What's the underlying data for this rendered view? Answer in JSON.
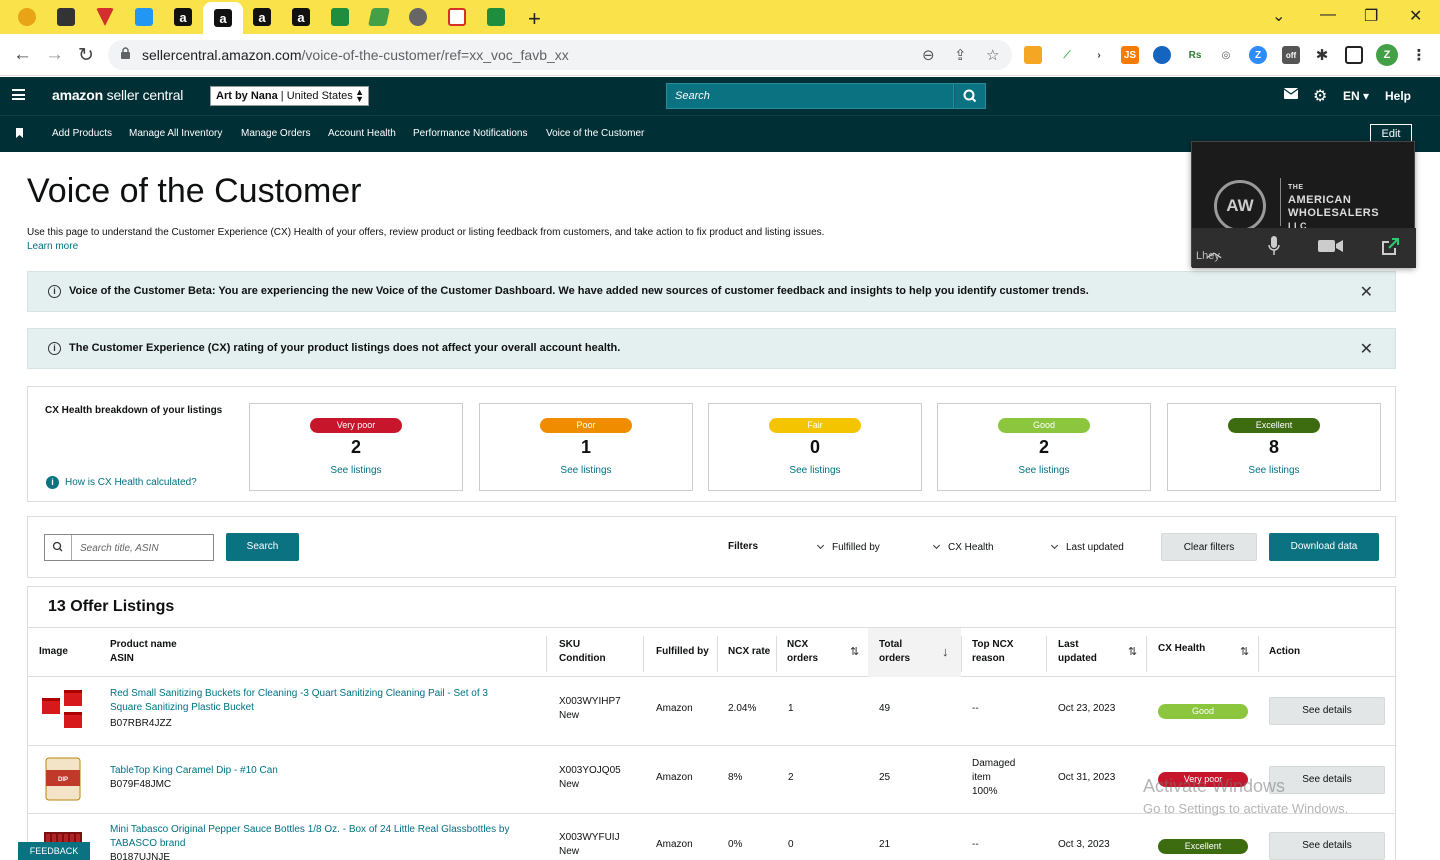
{
  "browser": {
    "url_host": "sellercentral.amazon.com",
    "url_path": "/voice-of-the-customer/ref=xx_voc_favb_xx",
    "new_tab_label": "+",
    "tab_glyphs": [
      "a",
      "a",
      "a",
      "a"
    ]
  },
  "header": {
    "logo_main": "amazon",
    "logo_sub": "seller central",
    "store_name": "Art by Nana",
    "store_region": "United States",
    "search_placeholder": "Search",
    "lang": "EN",
    "help": "Help"
  },
  "nav": {
    "items": [
      "Add Products",
      "Manage All Inventory",
      "Manage Orders",
      "Account Health",
      "Performance Notifications",
      "Voice of the Customer"
    ],
    "edit": "Edit"
  },
  "page": {
    "title": "Voice of the Customer",
    "description": "Use this page to understand the Customer Experience (CX) Health of your offers, review product or listing feedback from customers, and take action to fix product and listing issues.",
    "learn_more": "Learn more"
  },
  "banners": [
    "Voice of the Customer Beta: You are experiencing the new Voice of the Customer Dashboard. We have added new sources of customer feedback and insights to help you identify customer trends.",
    "The Customer Experience (CX) rating of your product listings does not affect your overall account health."
  ],
  "cx_health": {
    "label": "CX Health breakdown of your listings",
    "how_link": "How is CX Health calculated?",
    "see_listings": "See listings",
    "cards": [
      {
        "rating": "Very poor",
        "count": "2",
        "color": "#c7162b"
      },
      {
        "rating": "Poor",
        "count": "1",
        "color": "#f08c00"
      },
      {
        "rating": "Fair",
        "count": "0",
        "color": "#f5c400"
      },
      {
        "rating": "Good",
        "count": "2",
        "color": "#8cc63f"
      },
      {
        "rating": "Excellent",
        "count": "8",
        "color": "#3d6b10"
      }
    ]
  },
  "filters": {
    "search_placeholder": "Search title, ASIN",
    "search_button": "Search",
    "filters_label": "Filters",
    "fulfilled_by": "Fulfilled by",
    "cx_health": "CX Health",
    "last_updated": "Last updated",
    "clear": "Clear filters",
    "download": "Download data"
  },
  "listings": {
    "title": "13 Offer Listings",
    "columns": {
      "image": "Image",
      "product_name": "Product name",
      "asin": "ASIN",
      "sku": "SKU",
      "condition": "Condition",
      "fulfilled_by": "Fulfilled by",
      "ncx_rate": "NCX rate",
      "ncx_orders_1": "NCX",
      "ncx_orders_2": "orders",
      "total_orders_1": "Total",
      "total_orders_2": "orders",
      "top_ncx_1": "Top NCX",
      "top_ncx_2": "reason",
      "last_updated_1": "Last",
      "last_updated_2": "updated",
      "cx_health": "CX Health",
      "action": "Action"
    },
    "rows": [
      {
        "name_line1": "Red Small Sanitizing Buckets for Cleaning -3 Quart Sanitizing Cleaning Pail - Set of 3",
        "name_line2": "Square Sanitizing Plastic Bucket",
        "asin": "B07RBR4JZZ",
        "sku": "X003WYIHP7",
        "condition": "New",
        "fulfilled_by": "Amazon",
        "ncx_rate": "2.04%",
        "ncx_orders": "1",
        "total_orders": "49",
        "reason_1": "--",
        "reason_2": "",
        "reason_3": "",
        "last_updated": "Oct 23, 2023",
        "health": "Good",
        "health_color": "#8cc63f",
        "action": "See details"
      },
      {
        "name_line1": "TableTop King Caramel Dip - #10 Can",
        "name_line2": "",
        "asin": "B079F48JMC",
        "sku": "X003YOJQ05",
        "condition": "New",
        "fulfilled_by": "Amazon",
        "ncx_rate": "8%",
        "ncx_orders": "2",
        "total_orders": "25",
        "reason_1": "Damaged",
        "reason_2": "item",
        "reason_3": "100%",
        "last_updated": "Oct 31, 2023",
        "health": "Very poor",
        "health_color": "#c7162b",
        "action": "See details"
      },
      {
        "name_line1": "Mini Tabasco Original Pepper Sauce Bottles 1/8 Oz. - Box of 24 Little Real Glassbottles by",
        "name_line2": "TABASCO brand",
        "asin": "B0187UJNJE",
        "sku": "X003WYFUIJ",
        "condition": "New",
        "fulfilled_by": "Amazon",
        "ncx_rate": "0%",
        "ncx_orders": "0",
        "total_orders": "21",
        "reason_1": "--",
        "reason_2": "",
        "reason_3": "",
        "last_updated": "Oct 3, 2023",
        "health": "Excellent",
        "health_color": "#3d6b10",
        "action": "See details"
      }
    ]
  },
  "video": {
    "brand_line1": "THE",
    "brand_line2": "AMERICAN",
    "brand_line3": "WHOLESALERS",
    "brand_line4": "LLC",
    "logo_letters": "AW",
    "participant": "Lhey"
  },
  "feedback": "FEEDBACK",
  "watermark": {
    "line1": "Activate Windows",
    "line2": "Go to Settings to activate Windows."
  }
}
